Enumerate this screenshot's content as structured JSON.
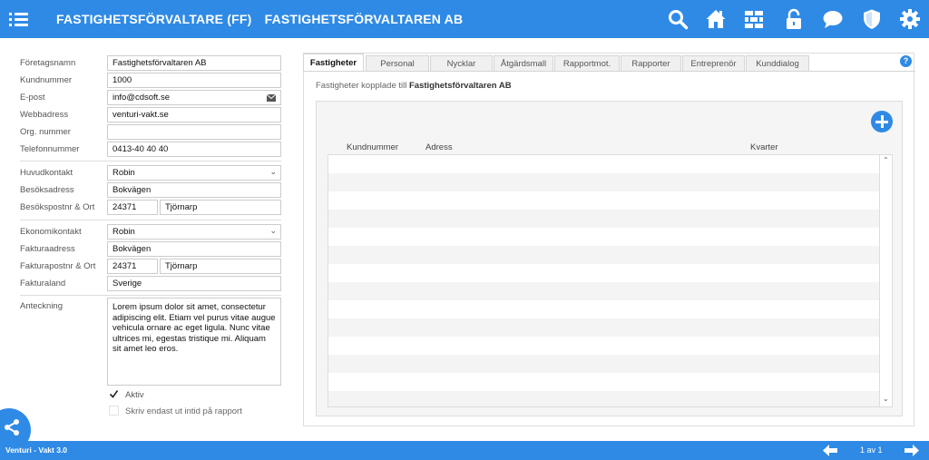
{
  "header": {
    "title_short": "FASTIGHETSFÖRVALTARE (FF)",
    "title_name": "FASTIGHETSFÖRVALTAREN AB",
    "icons": [
      "menu-icon",
      "search-icon",
      "home-icon",
      "brick-wall-icon",
      "unlock-icon",
      "chat-icon",
      "shield-icon",
      "gear-icon"
    ]
  },
  "form": {
    "company_label": "Företagsnamn",
    "company_value": "Fastighetsförvaltaren AB",
    "custno_label": "Kundnummer",
    "custno_value": "1000",
    "email_label": "E-post",
    "email_value": "info@cdsoft.se",
    "web_label": "Webbadress",
    "web_value": "venturi-vakt.se",
    "orgno_label": "Org. nummer",
    "orgno_value": "",
    "phone_label": "Telefonnummer",
    "phone_value": "0413-40 40 40",
    "main_contact_label": "Huvudkontakt",
    "main_contact_value": "Robin",
    "visit_address_label": "Besöksadress",
    "visit_address_value": "Bokvägen",
    "visit_postal_label": "Besökspostnr & Ort",
    "visit_zip": "24371",
    "visit_city": "Tjörnarp",
    "economy_contact_label": "Ekonomikontakt",
    "economy_contact_value": "Robin",
    "invoice_address_label": "Fakturaadress",
    "invoice_address_value": "Bokvägen",
    "invoice_postal_label": "Fakturapostnr & Ort",
    "invoice_zip": "24371",
    "invoice_city": "Tjörnarp",
    "invoice_country_label": "Fakturaland",
    "invoice_country_value": "Sverige",
    "note_label": "Anteckning",
    "note_value": "Lorem ipsum dolor sit amet, consectetur adipiscing elit. Etiam vel purus vitae augue vehicula ornare ac eget ligula. Nunc vitae ultrices mi, egestas tristique mi. Aliquam sit amet leo eros.",
    "active_label": "Aktiv",
    "active_checked": true,
    "intid_label": "Skriv endast ut intid på rapport",
    "intid_checked": false
  },
  "tabs": [
    "Fastigheter",
    "Personal",
    "Nycklar",
    "Åtgärdsmall",
    "Rapportmot.",
    "Rapporter",
    "Entreprenör",
    "Kunddialog"
  ],
  "active_tab": "Fastigheter",
  "panel": {
    "subtitle_prefix": "Fastigheter kopplade till",
    "subtitle_company": "Fastighetsförvaltaren AB",
    "help": "?",
    "columns": [
      "Kundnummer",
      "Adress",
      "Kvarter"
    ],
    "rows": []
  },
  "footer": {
    "version": "Venturi - Vakt 3.0",
    "page_indicator": "1 av 1"
  },
  "colors": {
    "accent": "#2f8ae6"
  }
}
